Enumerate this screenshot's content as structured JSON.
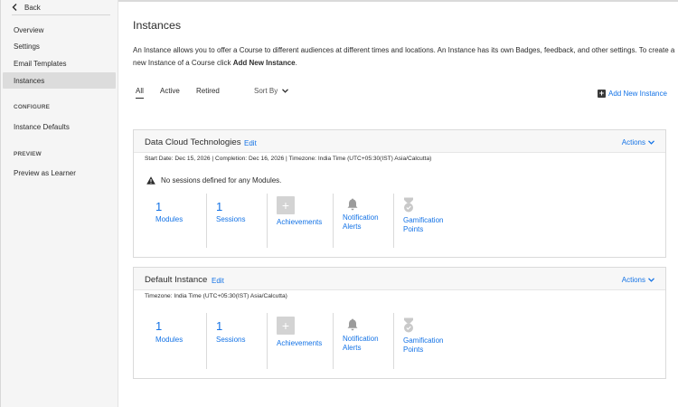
{
  "sidebar": {
    "back_label": "Back",
    "items": [
      {
        "label": "Overview"
      },
      {
        "label": "Settings"
      },
      {
        "label": "Email Templates"
      },
      {
        "label": "Instances",
        "active": true
      }
    ],
    "configure_heading": "CONFIGURE",
    "configure_items": [
      {
        "label": "Instance Defaults"
      }
    ],
    "preview_heading": "PREVIEW",
    "preview_items": [
      {
        "label": "Preview as Learner"
      }
    ]
  },
  "main": {
    "title": "Instances",
    "description_part1": "An Instance allows you to offer a Course to different audiences at different times and locations. An Instance has its own Badges, feedback, and other settings. To create a new Instance of a Course click ",
    "description_bold": "Add New Instance",
    "description_end": ".",
    "tabs": [
      {
        "label": "All",
        "active": true
      },
      {
        "label": "Active"
      },
      {
        "label": "Retired"
      }
    ],
    "sort_label": "Sort By",
    "add_new_label": "Add New Instance",
    "accent_color": "#1473e6"
  },
  "instances": [
    {
      "name": "Data Cloud Technologies",
      "edit_label": "Edit",
      "actions_label": "Actions",
      "meta": "Start Date: Dec 15, 2026 | Completion: Dec 16, 2026 | Timezone: India Time (UTC+05:30(IST) Asia/Calcutta)",
      "warning": "No sessions defined for any Modules.",
      "stats": {
        "modules_count": "1",
        "modules_label": "Modules",
        "sessions_count": "1",
        "sessions_label": "Sessions",
        "achievements_label": "Achievements",
        "notification_line1": "Notification",
        "notification_line2": "Alerts",
        "gamification_line1": "Gamification",
        "gamification_line2": "Points"
      }
    },
    {
      "name": "Default Instance",
      "edit_label": "Edit",
      "actions_label": "Actions",
      "meta": "Timezone: India Time (UTC+05:30(IST) Asia/Calcutta)",
      "stats": {
        "modules_count": "1",
        "modules_label": "Modules",
        "sessions_count": "1",
        "sessions_label": "Sessions",
        "achievements_label": "Achievements",
        "notification_line1": "Notification",
        "notification_line2": "Alerts",
        "gamification_line1": "Gamification",
        "gamification_line2": "Points"
      }
    }
  ]
}
